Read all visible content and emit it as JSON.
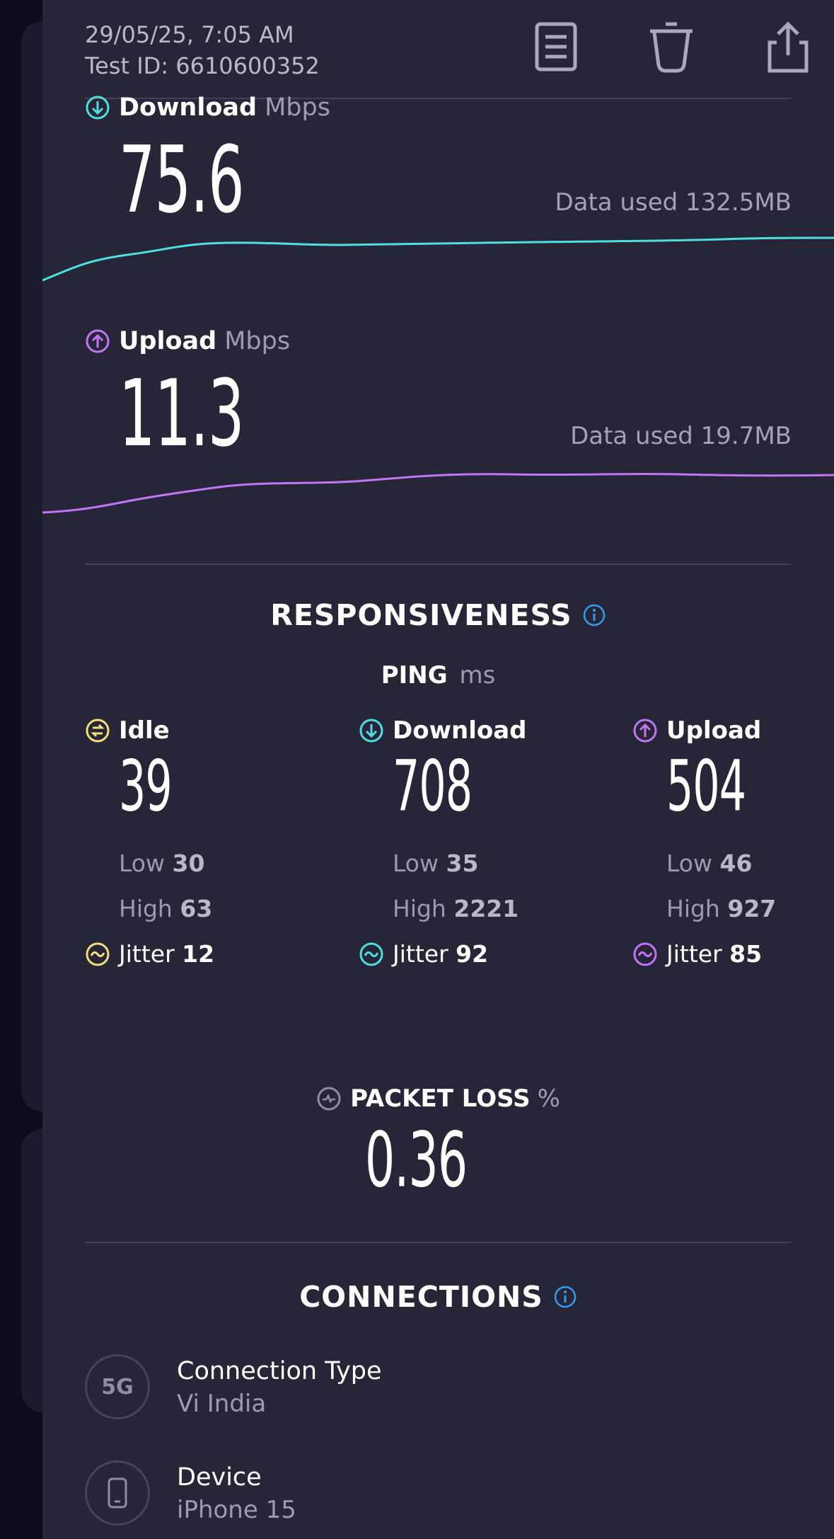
{
  "header": {
    "datetime": "29/05/25, 7:05 AM",
    "test_id": "Test ID: 6610600352"
  },
  "download": {
    "label": "Download",
    "unit": "Mbps",
    "value": "75.6",
    "data_used": "Data used 132.5MB",
    "color": "#4ee0e0"
  },
  "upload": {
    "label": "Upload",
    "unit": "Mbps",
    "value": "11.3",
    "data_used": "Data used 19.7MB",
    "color": "#c276f5"
  },
  "responsiveness": {
    "title": "RESPONSIVENESS",
    "ping_label": "PING",
    "ping_unit": "ms",
    "columns": [
      {
        "label": "Idle",
        "value": "39",
        "low_label": "Low",
        "low": "30",
        "high_label": "High",
        "high": "63",
        "jitter_label": "Jitter",
        "jitter": "12",
        "color": "#f2e27a"
      },
      {
        "label": "Download",
        "value": "708",
        "low_label": "Low",
        "low": "35",
        "high_label": "High",
        "high": "2221",
        "jitter_label": "Jitter",
        "jitter": "92",
        "color": "#4ee0e0"
      },
      {
        "label": "Upload",
        "value": "504",
        "low_label": "Low",
        "low": "46",
        "high_label": "High",
        "high": "927",
        "jitter_label": "Jitter",
        "jitter": "85",
        "color": "#c276f5"
      }
    ]
  },
  "packet_loss": {
    "label": "PACKET LOSS",
    "unit": "%",
    "value": "0.36"
  },
  "connections": {
    "title": "CONNECTIONS",
    "items": [
      {
        "icon_text": "5G",
        "title": "Connection Type",
        "value": "Vi India"
      },
      {
        "icon": "phone-icon",
        "title": "Device",
        "value": "iPhone 15"
      }
    ]
  },
  "colors": {
    "info": "#2f9ef0",
    "sheet": "#262638"
  }
}
